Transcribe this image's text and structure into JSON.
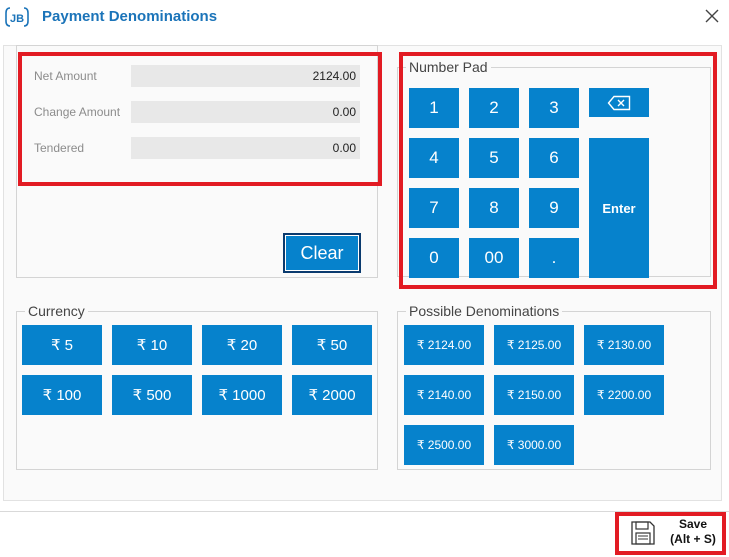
{
  "window": {
    "title": "Payment Denominations",
    "logo_text": "JB"
  },
  "amounts": {
    "net_amount_label": "Net Amount",
    "net_amount_value": "2124.00",
    "change_amount_label": "Change Amount",
    "change_amount_value": "0.00",
    "tendered_label": "Tendered",
    "tendered_value": "0.00",
    "clear_label": "Clear"
  },
  "number_pad": {
    "title": "Number Pad",
    "keys": [
      "1",
      "2",
      "3",
      "4",
      "5",
      "6",
      "7",
      "8",
      "9",
      "0",
      "00",
      "."
    ],
    "enter_label": "Enter"
  },
  "currency": {
    "title": "Currency",
    "buttons": [
      "₹ 5",
      "₹ 10",
      "₹ 20",
      "₹ 50",
      "₹ 100",
      "₹ 500",
      "₹ 1000",
      "₹ 2000"
    ]
  },
  "possible_denominations": {
    "title": "Possible Denominations",
    "buttons": [
      "₹ 2124.00",
      "₹ 2125.00",
      "₹ 2130.00",
      "₹ 2140.00",
      "₹ 2150.00",
      "₹ 2200.00",
      "₹ 2500.00",
      "₹ 3000.00"
    ]
  },
  "footer": {
    "save_label": "Save",
    "save_shortcut": "(Alt + S)"
  },
  "colors": {
    "accent": "#0682cc",
    "title": "#1b74b9",
    "highlight": "#e21b23"
  }
}
